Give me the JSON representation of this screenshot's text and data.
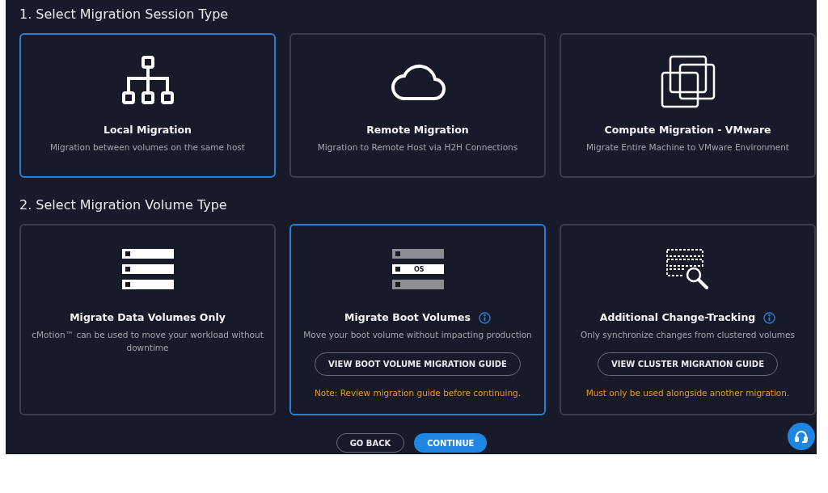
{
  "sections": [
    {
      "heading": "1. Select Migration Session Type",
      "cards": [
        {
          "kind": "hierarchy",
          "selected": true,
          "title": "Local Migration",
          "description": "Migration between volumes on the same host"
        },
        {
          "kind": "cloud",
          "selected": false,
          "title": "Remote Migration",
          "description": "Migration to Remote Host via H2H Connections"
        },
        {
          "kind": "windows",
          "selected": false,
          "title": "Compute Migration - VMware",
          "description": "Migrate Entire Machine to VMware Environment"
        }
      ]
    },
    {
      "heading": "2. Select Migration Volume Type",
      "cards": [
        {
          "kind": "servers",
          "selected": false,
          "title": "Migrate Data Volumes Only",
          "description": "cMotion™ can be used to move your workload without downtime"
        },
        {
          "kind": "servers-os",
          "icon_label": "OS",
          "selected": true,
          "title": "Migrate Boot Volumes",
          "info": true,
          "description": "Move your boot volume without impacting production",
          "guide_button": "VIEW BOOT VOLUME MIGRATION GUIDE",
          "note": "Note: Review migration guide before continuing."
        },
        {
          "kind": "dotted-search",
          "selected": false,
          "title": "Additional Change-Tracking",
          "info": true,
          "description": "Only synchronize changes from clustered volumes",
          "guide_button": "VIEW CLUSTER MIGRATION GUIDE",
          "note": "Must only be used alongside another migration."
        }
      ]
    }
  ],
  "buttons": {
    "back": "GO BACK",
    "continue": "CONTINUE"
  }
}
